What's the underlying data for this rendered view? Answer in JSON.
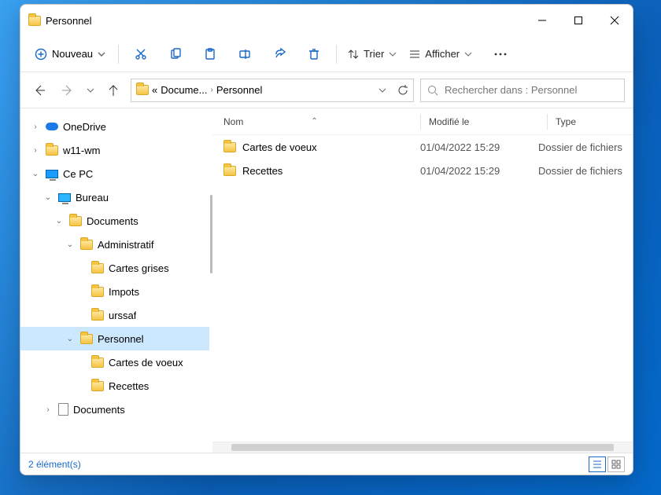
{
  "title": "Personnel",
  "toolbar": {
    "new_label": "Nouveau",
    "sort_label": "Trier",
    "view_label": "Afficher"
  },
  "breadcrumb": {
    "seg1": "Docume...",
    "seg2": "Personnel"
  },
  "search": {
    "placeholder": "Rechercher dans : Personnel"
  },
  "tree": {
    "onedrive": "OneDrive",
    "w11": "w11-wm",
    "pc": "Ce PC",
    "desktop": "Bureau",
    "docs": "Documents",
    "admin": "Administratif",
    "cg": "Cartes grises",
    "imp": "Impots",
    "urs": "urssaf",
    "pers": "Personnel",
    "cv": "Cartes de voeux",
    "rec": "Recettes",
    "docs2": "Documents"
  },
  "columns": {
    "name": "Nom",
    "mod": "Modifié le",
    "type": "Type"
  },
  "rows": [
    {
      "name": "Cartes de voeux",
      "mod": "01/04/2022 15:29",
      "type": "Dossier de fichiers"
    },
    {
      "name": "Recettes",
      "mod": "01/04/2022 15:29",
      "type": "Dossier de fichiers"
    }
  ],
  "status": "2 élément(s)"
}
